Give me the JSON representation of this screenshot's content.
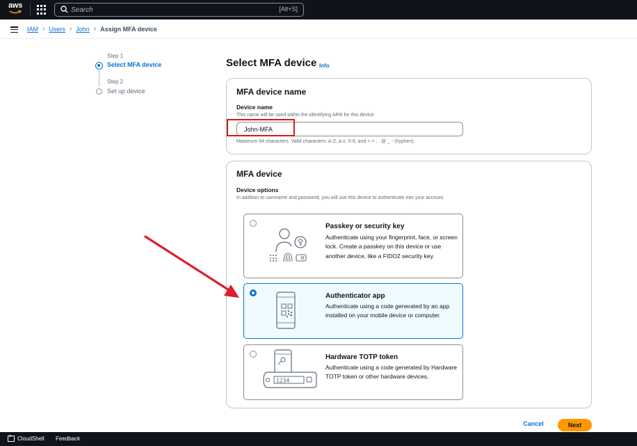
{
  "topnav": {
    "logo_text": "aws",
    "search_placeholder": "Search",
    "search_shortcut": "[Alt+S]"
  },
  "breadcrumb": {
    "items": [
      "IAM",
      "Users",
      "John"
    ],
    "current": "Assign MFA device"
  },
  "stepper": {
    "steps": [
      {
        "number": "Step 1",
        "label": "Select MFA device",
        "active": true
      },
      {
        "number": "Step 2",
        "label": "Set up device",
        "active": false
      }
    ]
  },
  "page": {
    "title": "Select MFA device",
    "info": "Info"
  },
  "device_name_panel": {
    "title": "MFA device name",
    "field_label": "Device name",
    "field_description": "This name will be used within the identifying ARN for this device.",
    "value": "John-MFA",
    "constraint": "Maximum 64 characters. Valid characters: A-Z, a-z, 0-9, and + = , . @ _ - (hyphen)"
  },
  "mfa_device_panel": {
    "title": "MFA device",
    "options_label": "Device options",
    "options_description": "In addition to username and password, you will use this device to authenticate into your account.",
    "options": [
      {
        "title": "Passkey or security key",
        "description": "Authenticate using your fingerprint, face, or screen lock. Create a passkey on this device or use another device, like a FIDO2 security key.",
        "selected": false
      },
      {
        "title": "Authenticator app",
        "description": "Authenticate using a code generated by an app installed on your mobile device or computer.",
        "selected": true
      },
      {
        "title": "Hardware TOTP token",
        "description": "Authenticate using a code generated by Hardware TOTP token or other hardware devices.",
        "selected": false
      }
    ],
    "token_display": "1234"
  },
  "footer": {
    "cancel": "Cancel",
    "next": "Next"
  },
  "bottombar": {
    "cloudshell": "CloudShell",
    "feedback": "Feedback"
  },
  "colors": {
    "nav_bg": "#0f141a",
    "link_blue": "#0972d3",
    "primary_orange": "#ff9900",
    "highlight_red": "#d91515",
    "selected_tile_bg": "#f0fbff"
  }
}
